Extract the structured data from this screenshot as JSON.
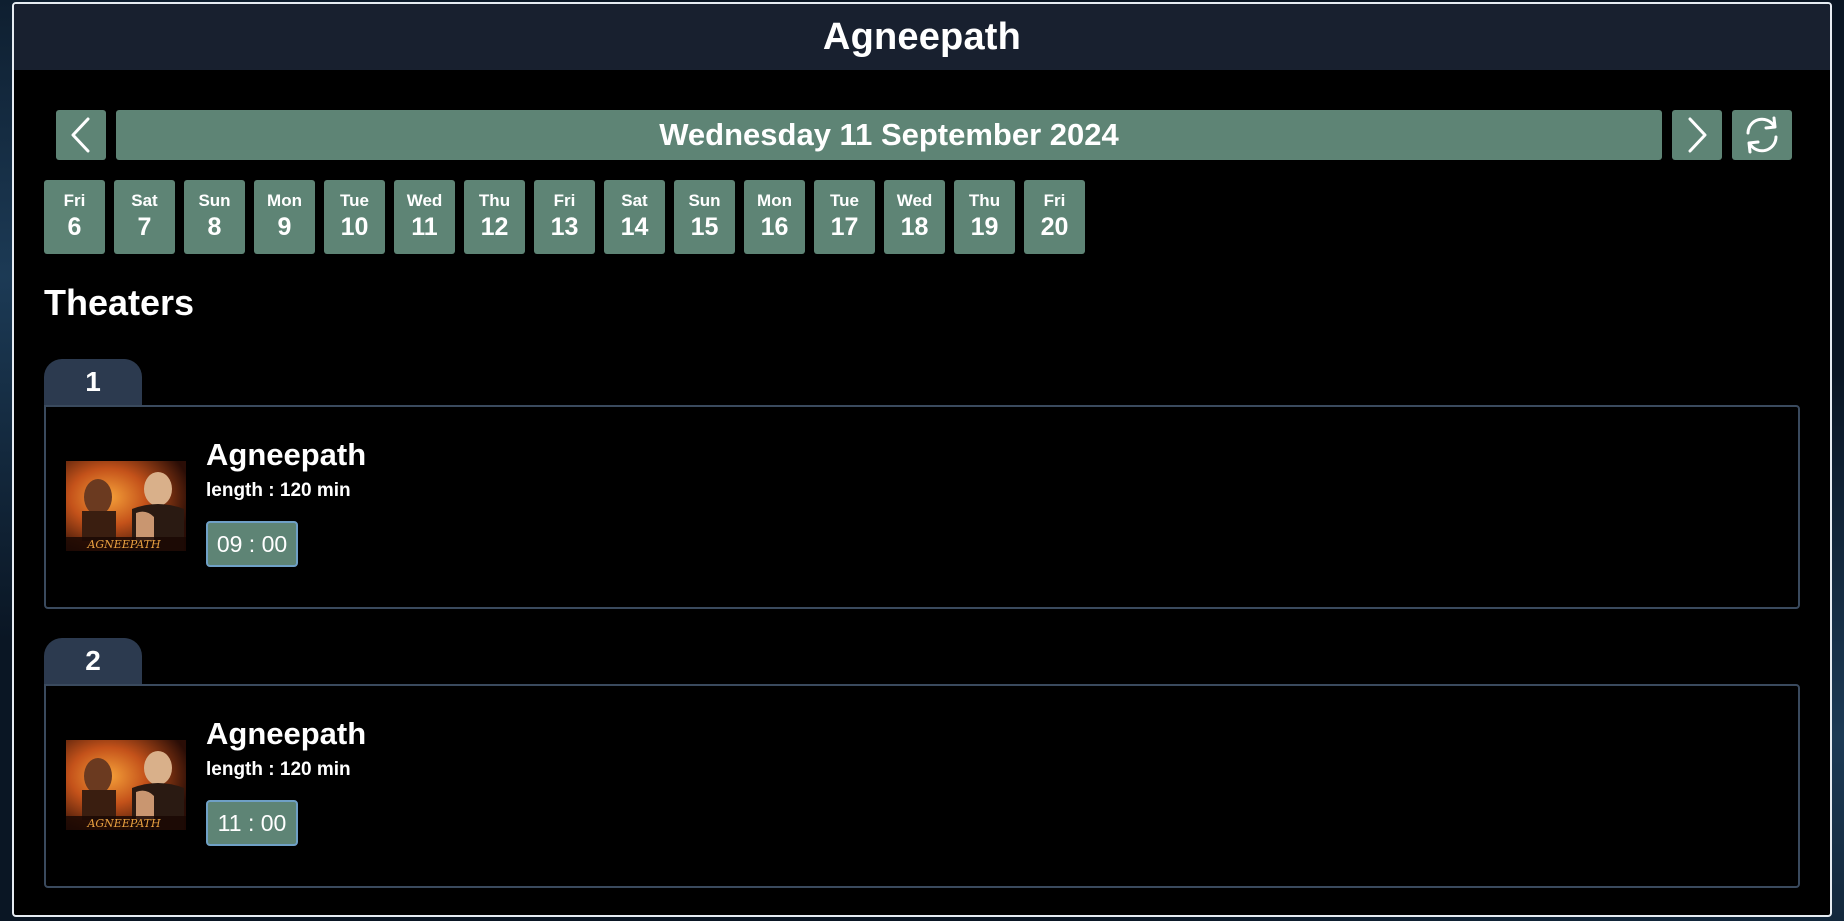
{
  "header": {
    "title": "Agneepath"
  },
  "nav": {
    "prev_icon": "chevron-left-icon",
    "next_icon": "chevron-right-icon",
    "refresh_icon": "refresh-icon",
    "selected_date": "Wednesday 11 September 2024"
  },
  "days": [
    {
      "name": "Fri",
      "num": "6"
    },
    {
      "name": "Sat",
      "num": "7"
    },
    {
      "name": "Sun",
      "num": "8"
    },
    {
      "name": "Mon",
      "num": "9"
    },
    {
      "name": "Tue",
      "num": "10"
    },
    {
      "name": "Wed",
      "num": "11"
    },
    {
      "name": "Thu",
      "num": "12"
    },
    {
      "name": "Fri",
      "num": "13"
    },
    {
      "name": "Sat",
      "num": "14"
    },
    {
      "name": "Sun",
      "num": "15"
    },
    {
      "name": "Mon",
      "num": "16"
    },
    {
      "name": "Tue",
      "num": "17"
    },
    {
      "name": "Wed",
      "num": "18"
    },
    {
      "name": "Thu",
      "num": "19"
    },
    {
      "name": "Fri",
      "num": "20"
    }
  ],
  "section_title": "Theaters",
  "theaters": [
    {
      "number": "1",
      "movie": {
        "title": "Agneepath",
        "length": "length : 120 min",
        "showtime": "09 : 00",
        "poster_text": "AGNEEPATH"
      }
    },
    {
      "number": "2",
      "movie": {
        "title": "Agneepath",
        "length": "length : 120 min",
        "showtime": "11 : 00",
        "poster_text": "AGNEEPATH"
      }
    }
  ],
  "colors": {
    "accent": "#5e8475",
    "title_bar": "#18202f",
    "tab": "#2c3a4f",
    "card_border": "#3a4a5e",
    "background": "#000000"
  }
}
